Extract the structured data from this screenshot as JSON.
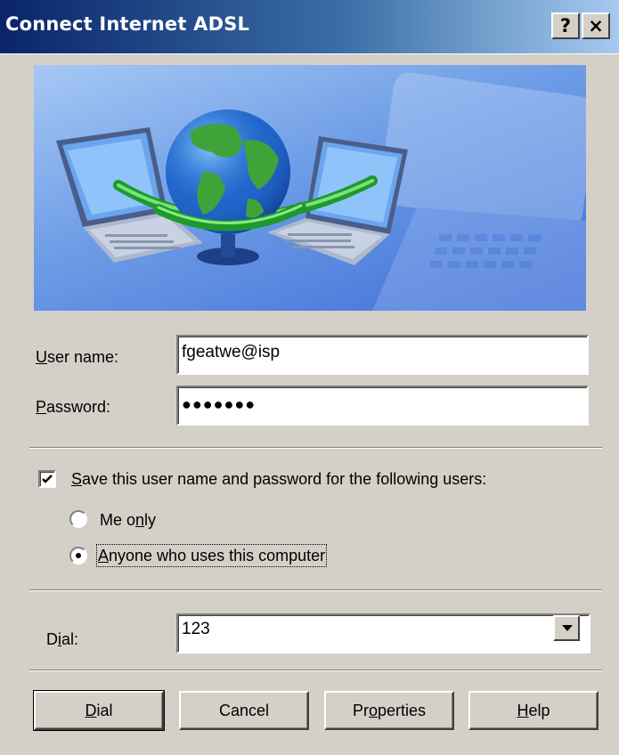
{
  "window": {
    "title": "Connect Internet ADSL",
    "help_button": "?",
    "close_button": "×"
  },
  "form": {
    "username_label": {
      "mnemonic": "U",
      "rest": "ser name:"
    },
    "username_value": "fgeatwe@isp",
    "password_label": {
      "mnemonic": "P",
      "rest": "assword:"
    },
    "password_value": "●●●●●●●",
    "save_checkbox": {
      "checked": true,
      "label_mnemonic": "S",
      "label_rest": "ave this user name and password for the following users:"
    },
    "radio_me_only": {
      "label_before": "Me o",
      "mnemonic": "n",
      "label_after": "ly",
      "selected": false
    },
    "radio_anyone": {
      "mnemonic": "A",
      "label_rest": "nyone who uses this computer",
      "selected": true
    },
    "dial_label": {
      "before": "D",
      "mnemonic": "i",
      "after": "al:"
    },
    "dial_value": "123"
  },
  "buttons": {
    "dial": {
      "mnemonic": "D",
      "rest": "ial"
    },
    "cancel": "Cancel",
    "properties": {
      "before": "Pr",
      "mnemonic": "o",
      "after": "perties"
    },
    "help": {
      "mnemonic": "H",
      "rest": "elp"
    }
  },
  "banner": {
    "icon_name": "network-connection-globe-laptops-image"
  }
}
